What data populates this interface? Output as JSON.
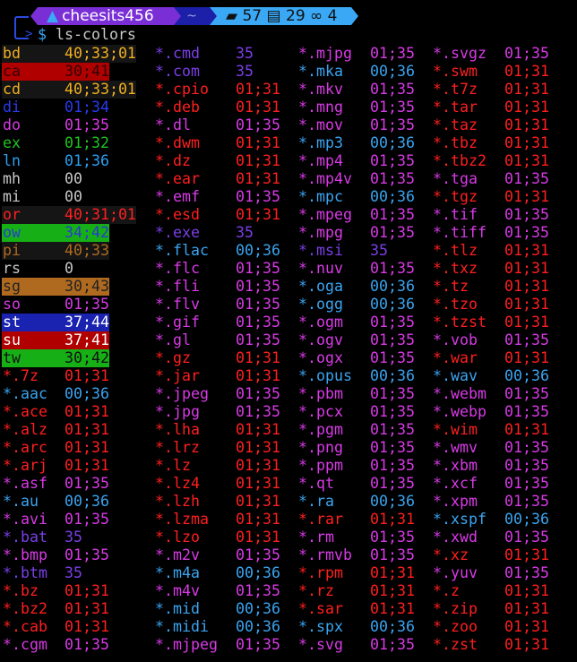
{
  "prompt": {
    "user": "cheesits456",
    "dir": "~",
    "folders": "57",
    "files": "29",
    "links": "4",
    "symbol": "$",
    "command": "ls-colors"
  },
  "colors": {
    "35": "#7a3fe6",
    "01;35": "#d83ae6",
    "01;31": "#ff1f1f",
    "00;36": "#3aa4f0",
    "01;34": "#2a3af0",
    "01;32": "#1ec41e",
    "01;36": "#2aa0f0",
    "00": "#c8c8c8",
    "0": "#c8c8c8",
    "40;33;01": {
      "fg": "#f0b020",
      "bg": "#151515"
    },
    "30;41": {
      "fg": "#330000",
      "bg": "#b00000"
    },
    "40;31;01": {
      "fg": "#ff2020",
      "bg": "#151515"
    },
    "34;42": {
      "fg": "#2a3ad0",
      "bg": "#16b016"
    },
    "40;33": {
      "fg": "#b06a20",
      "bg": "#151515"
    },
    "30;43": {
      "fg": "#222222",
      "bg": "#b06a20"
    },
    "37;44": {
      "fg": "#ffffff",
      "bg": "#1a22b0"
    },
    "37;41": {
      "fg": "#ffffff",
      "bg": "#b00000"
    },
    "30;42": {
      "fg": "#111111",
      "bg": "#16b016"
    }
  },
  "columns": [
    [
      {
        "n": "bd",
        "v": "40;33;01"
      },
      {
        "n": "ca",
        "v": "30;41"
      },
      {
        "n": "cd",
        "v": "40;33;01"
      },
      {
        "n": "di",
        "v": "01;34"
      },
      {
        "n": "do",
        "v": "01;35"
      },
      {
        "n": "ex",
        "v": "01;32"
      },
      {
        "n": "ln",
        "v": "01;36"
      },
      {
        "n": "mh",
        "v": "00"
      },
      {
        "n": "mi",
        "v": "00"
      },
      {
        "n": "or",
        "v": "40;31;01"
      },
      {
        "n": "ow",
        "v": "34;42"
      },
      {
        "n": "pi",
        "v": "40;33"
      },
      {
        "n": "rs",
        "v": "0"
      },
      {
        "n": "sg",
        "v": "30;43"
      },
      {
        "n": "so",
        "v": "01;35"
      },
      {
        "n": "st",
        "v": "37;44"
      },
      {
        "n": "su",
        "v": "37;41"
      },
      {
        "n": "tw",
        "v": "30;42"
      },
      {
        "n": "*.7z",
        "v": "01;31"
      },
      {
        "n": "*.aac",
        "v": "00;36"
      },
      {
        "n": "*.ace",
        "v": "01;31"
      },
      {
        "n": "*.alz",
        "v": "01;31"
      },
      {
        "n": "*.arc",
        "v": "01;31"
      },
      {
        "n": "*.arj",
        "v": "01;31"
      },
      {
        "n": "*.asf",
        "v": "01;35"
      },
      {
        "n": "*.au",
        "v": "00;36"
      },
      {
        "n": "*.avi",
        "v": "01;35"
      },
      {
        "n": "*.bat",
        "v": "35"
      },
      {
        "n": "*.bmp",
        "v": "01;35"
      },
      {
        "n": "*.btm",
        "v": "35"
      },
      {
        "n": "*.bz",
        "v": "01;31"
      },
      {
        "n": "*.bz2",
        "v": "01;31"
      },
      {
        "n": "*.cab",
        "v": "01;31"
      },
      {
        "n": "*.cgm",
        "v": "01;35"
      }
    ],
    [
      {
        "n": "*.cmd",
        "v": "35"
      },
      {
        "n": "*.com",
        "v": "35"
      },
      {
        "n": "*.cpio",
        "v": "01;31"
      },
      {
        "n": "*.deb",
        "v": "01;31"
      },
      {
        "n": "*.dl",
        "v": "01;35"
      },
      {
        "n": "*.dwm",
        "v": "01;31"
      },
      {
        "n": "*.dz",
        "v": "01;31"
      },
      {
        "n": "*.ear",
        "v": "01;31"
      },
      {
        "n": "*.emf",
        "v": "01;35"
      },
      {
        "n": "*.esd",
        "v": "01;31"
      },
      {
        "n": "*.exe",
        "v": "35"
      },
      {
        "n": "*.flac",
        "v": "00;36"
      },
      {
        "n": "*.flc",
        "v": "01;35"
      },
      {
        "n": "*.fli",
        "v": "01;35"
      },
      {
        "n": "*.flv",
        "v": "01;35"
      },
      {
        "n": "*.gif",
        "v": "01;35"
      },
      {
        "n": "*.gl",
        "v": "01;35"
      },
      {
        "n": "*.gz",
        "v": "01;31"
      },
      {
        "n": "*.jar",
        "v": "01;31"
      },
      {
        "n": "*.jpeg",
        "v": "01;35"
      },
      {
        "n": "*.jpg",
        "v": "01;35"
      },
      {
        "n": "*.lha",
        "v": "01;31"
      },
      {
        "n": "*.lrz",
        "v": "01;31"
      },
      {
        "n": "*.lz",
        "v": "01;31"
      },
      {
        "n": "*.lz4",
        "v": "01;31"
      },
      {
        "n": "*.lzh",
        "v": "01;31"
      },
      {
        "n": "*.lzma",
        "v": "01;31"
      },
      {
        "n": "*.lzo",
        "v": "01;31"
      },
      {
        "n": "*.m2v",
        "v": "01;35"
      },
      {
        "n": "*.m4a",
        "v": "00;36"
      },
      {
        "n": "*.m4v",
        "v": "01;35"
      },
      {
        "n": "*.mid",
        "v": "00;36"
      },
      {
        "n": "*.midi",
        "v": "00;36"
      },
      {
        "n": "*.mjpeg",
        "v": "01;35"
      }
    ],
    [
      {
        "n": "*.mjpg",
        "v": "01;35"
      },
      {
        "n": "*.mka",
        "v": "00;36"
      },
      {
        "n": "*.mkv",
        "v": "01;35"
      },
      {
        "n": "*.mng",
        "v": "01;35"
      },
      {
        "n": "*.mov",
        "v": "01;35"
      },
      {
        "n": "*.mp3",
        "v": "00;36"
      },
      {
        "n": "*.mp4",
        "v": "01;35"
      },
      {
        "n": "*.mp4v",
        "v": "01;35"
      },
      {
        "n": "*.mpc",
        "v": "00;36"
      },
      {
        "n": "*.mpeg",
        "v": "01;35"
      },
      {
        "n": "*.mpg",
        "v": "01;35"
      },
      {
        "n": "*.msi",
        "v": "35"
      },
      {
        "n": "*.nuv",
        "v": "01;35"
      },
      {
        "n": "*.oga",
        "v": "00;36"
      },
      {
        "n": "*.ogg",
        "v": "00;36"
      },
      {
        "n": "*.ogm",
        "v": "01;35"
      },
      {
        "n": "*.ogv",
        "v": "01;35"
      },
      {
        "n": "*.ogx",
        "v": "01;35"
      },
      {
        "n": "*.opus",
        "v": "00;36"
      },
      {
        "n": "*.pbm",
        "v": "01;35"
      },
      {
        "n": "*.pcx",
        "v": "01;35"
      },
      {
        "n": "*.pgm",
        "v": "01;35"
      },
      {
        "n": "*.png",
        "v": "01;35"
      },
      {
        "n": "*.ppm",
        "v": "01;35"
      },
      {
        "n": "*.qt",
        "v": "01;35"
      },
      {
        "n": "*.ra",
        "v": "00;36"
      },
      {
        "n": "*.rar",
        "v": "01;31"
      },
      {
        "n": "*.rm",
        "v": "01;35"
      },
      {
        "n": "*.rmvb",
        "v": "01;35"
      },
      {
        "n": "*.rpm",
        "v": "01;31"
      },
      {
        "n": "*.rz",
        "v": "01;31"
      },
      {
        "n": "*.sar",
        "v": "01;31"
      },
      {
        "n": "*.spx",
        "v": "00;36"
      },
      {
        "n": "*.svg",
        "v": "01;35"
      }
    ],
    [
      {
        "n": "*.svgz",
        "v": "01;35"
      },
      {
        "n": "*.swm",
        "v": "01;31"
      },
      {
        "n": "*.t7z",
        "v": "01;31"
      },
      {
        "n": "*.tar",
        "v": "01;31"
      },
      {
        "n": "*.taz",
        "v": "01;31"
      },
      {
        "n": "*.tbz",
        "v": "01;31"
      },
      {
        "n": "*.tbz2",
        "v": "01;31"
      },
      {
        "n": "*.tga",
        "v": "01;35"
      },
      {
        "n": "*.tgz",
        "v": "01;31"
      },
      {
        "n": "*.tif",
        "v": "01;35"
      },
      {
        "n": "*.tiff",
        "v": "01;35"
      },
      {
        "n": "*.tlz",
        "v": "01;31"
      },
      {
        "n": "*.txz",
        "v": "01;31"
      },
      {
        "n": "*.tz",
        "v": "01;31"
      },
      {
        "n": "*.tzo",
        "v": "01;31"
      },
      {
        "n": "*.tzst",
        "v": "01;31"
      },
      {
        "n": "*.vob",
        "v": "01;35"
      },
      {
        "n": "*.war",
        "v": "01;31"
      },
      {
        "n": "*.wav",
        "v": "00;36"
      },
      {
        "n": "*.webm",
        "v": "01;35"
      },
      {
        "n": "*.webp",
        "v": "01;35"
      },
      {
        "n": "*.wim",
        "v": "01;31"
      },
      {
        "n": "*.wmv",
        "v": "01;35"
      },
      {
        "n": "*.xbm",
        "v": "01;35"
      },
      {
        "n": "*.xcf",
        "v": "01;35"
      },
      {
        "n": "*.xpm",
        "v": "01;35"
      },
      {
        "n": "*.xspf",
        "v": "00;36"
      },
      {
        "n": "*.xwd",
        "v": "01;35"
      },
      {
        "n": "*.xz",
        "v": "01;31"
      },
      {
        "n": "*.yuv",
        "v": "01;35"
      },
      {
        "n": "*.z",
        "v": "01;31"
      },
      {
        "n": "*.zip",
        "v": "01;31"
      },
      {
        "n": "*.zoo",
        "v": "01;31"
      },
      {
        "n": "*.zst",
        "v": "01;31"
      }
    ]
  ]
}
